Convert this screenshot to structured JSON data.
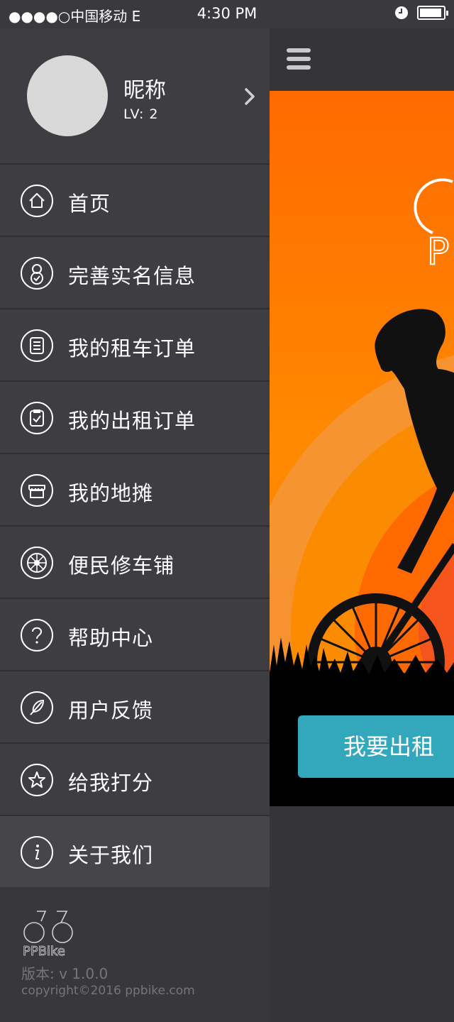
{
  "status_bar": {
    "carrier": "●●●●○中国移动 E",
    "time": "4:30 PM"
  },
  "profile": {
    "nickname": "昵称",
    "level": "LV: 2"
  },
  "menu": [
    {
      "label": "首页",
      "icon": "home-icon"
    },
    {
      "label": "完善实名信息",
      "icon": "user-verify-icon"
    },
    {
      "label": "我的租车订单",
      "icon": "order-list-icon"
    },
    {
      "label": "我的出租订单",
      "icon": "rental-order-icon"
    },
    {
      "label": "我的地摊",
      "icon": "stall-icon"
    },
    {
      "label": "便民修车铺",
      "icon": "wheel-icon"
    },
    {
      "label": "帮助中心",
      "icon": "help-icon"
    },
    {
      "label": "用户反馈",
      "icon": "feather-icon"
    },
    {
      "label": "给我打分",
      "icon": "star-icon"
    },
    {
      "label": "关于我们",
      "icon": "info-icon"
    }
  ],
  "footer": {
    "logo_text": "PPBike",
    "version": "版本: v 1.0.0",
    "copyright": "copyright©2016 ppbike.com"
  },
  "main": {
    "banner_logo_text": "P",
    "rent_button": "我要出租"
  },
  "colors": {
    "drawer_bg": "#3e3d42",
    "accent": "#33a8bd",
    "banner_orange": "#ff6f00"
  }
}
